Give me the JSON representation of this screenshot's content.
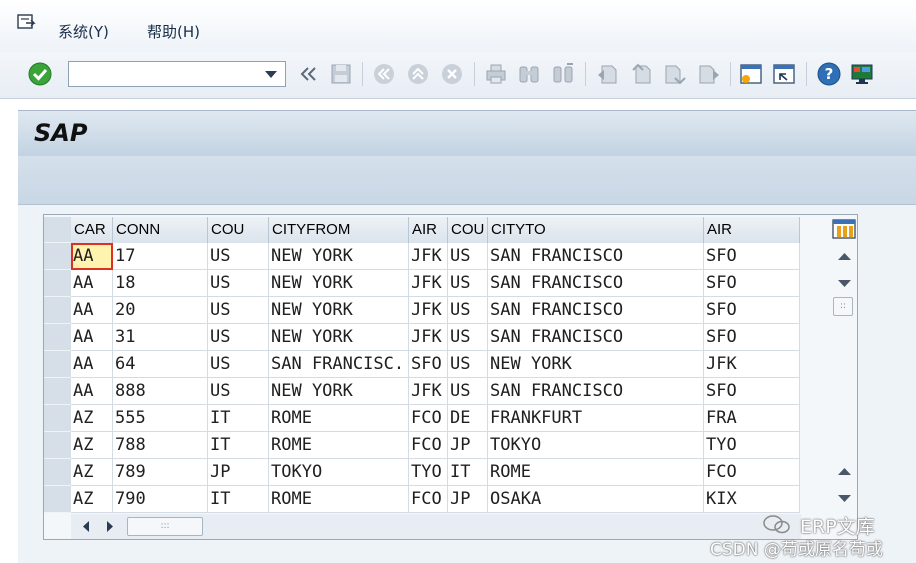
{
  "menu": {
    "items": [
      {
        "label": "系统(Y)"
      },
      {
        "label": "帮助(H)"
      }
    ]
  },
  "toolbar": {
    "command_field": {
      "value": "",
      "placeholder": ""
    },
    "buttons": [
      "enter-icon",
      "back-history-icon",
      "save-icon",
      "back-icon",
      "exit-icon",
      "cancel-icon",
      "print-icon",
      "find-icon",
      "find-next-icon",
      "first-page-icon",
      "prev-page-icon",
      "next-page-icon",
      "last-page-icon",
      "create-session-icon",
      "shortcut-icon",
      "help-icon",
      "layout-icon"
    ]
  },
  "title": {
    "text": "SAP"
  },
  "table": {
    "columns": [
      "CAR",
      "CONN",
      "COU",
      "CITYFROM",
      "AIR",
      "COU",
      "CITYTO",
      "AIR"
    ],
    "rows": [
      [
        "AA",
        "17",
        "US",
        "NEW YORK",
        "JFK",
        "US",
        "SAN FRANCISCO",
        "SFO"
      ],
      [
        "AA",
        "18",
        "US",
        "NEW YORK",
        "JFK",
        "US",
        "SAN FRANCISCO",
        "SFO"
      ],
      [
        "AA",
        "20",
        "US",
        "NEW YORK",
        "JFK",
        "US",
        "SAN FRANCISCO",
        "SFO"
      ],
      [
        "AA",
        "31",
        "US",
        "NEW YORK",
        "JFK",
        "US",
        "SAN FRANCISCO",
        "SFO"
      ],
      [
        "AA",
        "64",
        "US",
        "SAN FRANCISC..",
        "SFO",
        "US",
        "NEW YORK",
        "JFK"
      ],
      [
        "AA",
        "888",
        "US",
        "NEW YORK",
        "JFK",
        "US",
        "SAN FRANCISCO",
        "SFO"
      ],
      [
        "AZ",
        "555",
        "IT",
        "ROME",
        "FCO",
        "DE",
        "FRANKFURT",
        "FRA"
      ],
      [
        "AZ",
        "788",
        "IT",
        "ROME",
        "FCO",
        "JP",
        "TOKYO",
        "TYO"
      ],
      [
        "AZ",
        "789",
        "JP",
        "TOKYO",
        "TYO",
        "IT",
        "ROME",
        "FCO"
      ],
      [
        "AZ",
        "790",
        "IT",
        "ROME",
        "FCO",
        "JP",
        "OSAKA",
        "KIX"
      ]
    ],
    "hscroll_thumb": ":::",
    "vscroll_thumb": "::"
  },
  "watermark": {
    "line1": "ERP文库",
    "line2": "CSDN @苟或原名苟或"
  },
  "colors": {
    "title_bar": "#c2d2e2",
    "focus_cell": "#fff3b0",
    "focus_border": "#e03020",
    "enter_green": "#3aa33a",
    "help_blue": "#2f6fb5"
  }
}
